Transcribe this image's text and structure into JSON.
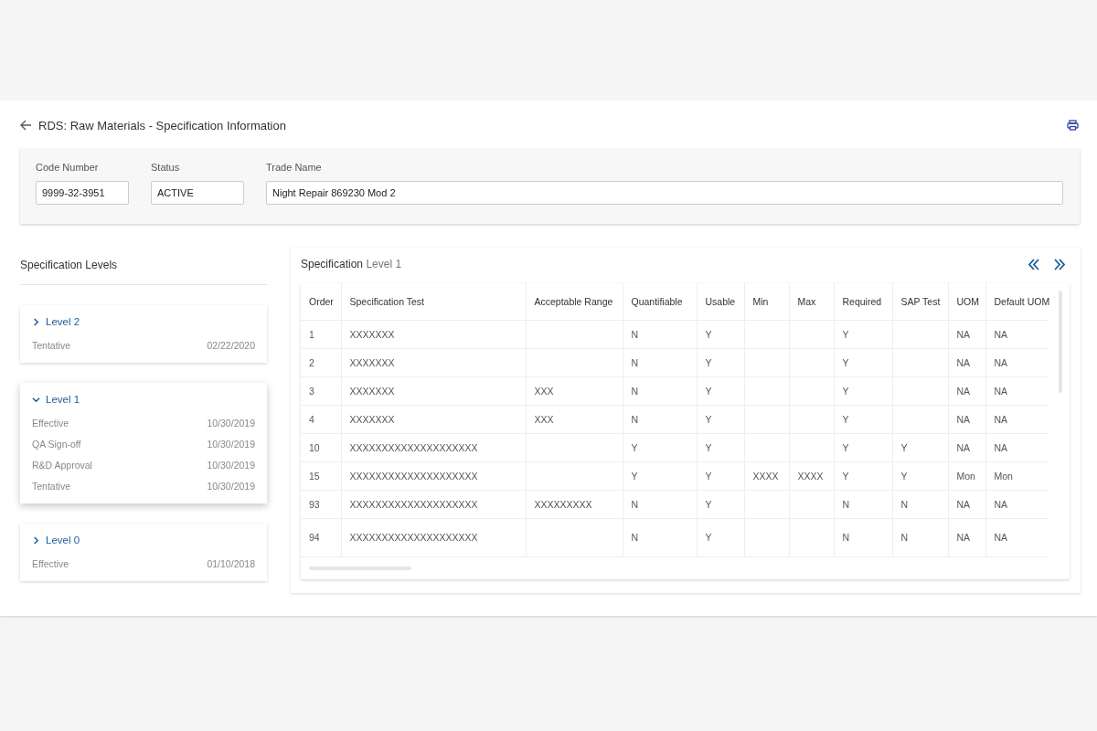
{
  "header": {
    "title": "RDS: Raw Materials - Specification Information"
  },
  "fields": [
    {
      "label": "Code Number",
      "value": "9999-32-3951",
      "kind": "short"
    },
    {
      "label": "Status",
      "value": "ACTIVE",
      "kind": "short"
    },
    {
      "label": "Trade Name",
      "value": "Night Repair 869230 Mod 2",
      "kind": "wide"
    }
  ],
  "levels_panel": {
    "title": "Specification Levels",
    "levels": [
      {
        "name": "Level 2",
        "expanded": false,
        "events": [
          {
            "label": "Tentative",
            "date": "02/22/2020"
          }
        ]
      },
      {
        "name": "Level 1",
        "expanded": true,
        "events": [
          {
            "label": "Effective",
            "date": "10/30/2019"
          },
          {
            "label": "QA Sign-off",
            "date": "10/30/2019"
          },
          {
            "label": "R&D Approval",
            "date": "10/30/2019"
          },
          {
            "label": "Tentative",
            "date": "10/30/2019"
          }
        ]
      },
      {
        "name": "Level 0",
        "expanded": false,
        "events": [
          {
            "label": "Effective",
            "date": "01/10/2018"
          }
        ]
      }
    ]
  },
  "spec_panel": {
    "title": "Specification",
    "level": "Level 1",
    "table": {
      "columns": [
        "Order",
        "Specification Test",
        "Acceptable Range",
        "Quantifiable",
        "Usable",
        "Min",
        "Max",
        "Required",
        "SAP Test",
        "UOM",
        "Default UOM"
      ],
      "rows": [
        [
          "1",
          "XXXXXXX",
          "",
          "N",
          "Y",
          "",
          "",
          "Y",
          "",
          "NA",
          "NA"
        ],
        [
          "2",
          "XXXXXXX",
          "",
          "N",
          "Y",
          "",
          "",
          "Y",
          "",
          "NA",
          "NA"
        ],
        [
          "3",
          "XXXXXXX",
          "XXX",
          "N",
          "Y",
          "",
          "",
          "Y",
          "",
          "NA",
          "NA"
        ],
        [
          "4",
          "XXXXXXX",
          "XXX",
          "N",
          "Y",
          "",
          "",
          "Y",
          "",
          "NA",
          "NA"
        ],
        [
          "10",
          "XXXXXXXXXXXXXXXXXXXX",
          "",
          "Y",
          "Y",
          "",
          "",
          "Y",
          "Y",
          "NA",
          "NA"
        ],
        [
          "15",
          "XXXXXXXXXXXXXXXXXXXX",
          "",
          "Y",
          "Y",
          "XXXX",
          "XXXX",
          "Y",
          "Y",
          "Mon",
          "Mon"
        ],
        [
          "93",
          "XXXXXXXXXXXXXXXXXXXX",
          "XXXXXXXXX",
          "N",
          "Y",
          "",
          "",
          "N",
          "N",
          "NA",
          "NA"
        ],
        [
          "94",
          "XXXXXXXXXXXXXXXXXXXX",
          "",
          "N",
          "Y",
          "",
          "",
          "N",
          "N",
          "NA",
          "NA"
        ]
      ]
    }
  }
}
